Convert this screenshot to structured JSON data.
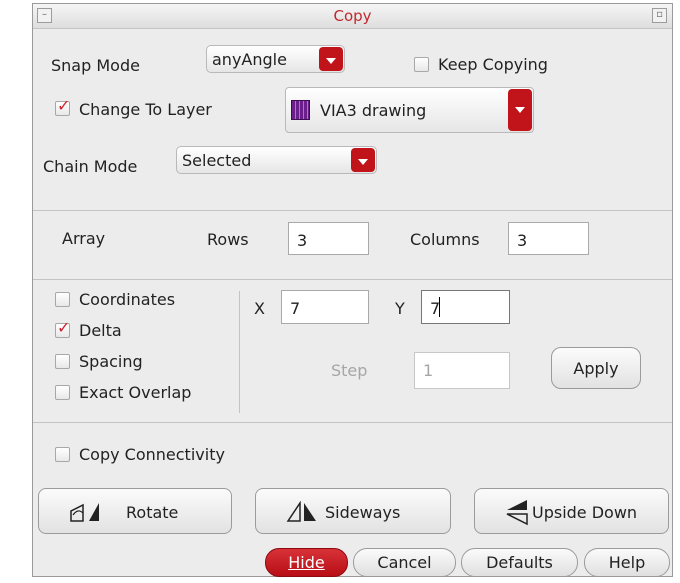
{
  "window": {
    "title": "Copy",
    "minimize_glyph": "–",
    "maximize_glyph": "▫"
  },
  "snap_mode": {
    "label": "Snap Mode",
    "value": "anyAngle"
  },
  "keep_copying": {
    "label": "Keep Copying",
    "checked": false
  },
  "change_to_layer": {
    "label": "Change To Layer",
    "checked": true,
    "value": "VIA3 drawing",
    "swatch_color": "#6a1f8a"
  },
  "chain_mode": {
    "label": "Chain Mode",
    "value": "Selected"
  },
  "array": {
    "label": "Array",
    "rows_label": "Rows",
    "rows_value": "3",
    "columns_label": "Columns",
    "columns_value": "3"
  },
  "mode": {
    "coordinates": {
      "label": "Coordinates",
      "checked": false
    },
    "delta": {
      "label": "Delta",
      "checked": true
    },
    "spacing": {
      "label": "Spacing",
      "checked": false
    },
    "exact_overlap": {
      "label": "Exact Overlap",
      "checked": false
    }
  },
  "offset": {
    "x_label": "X",
    "x_value": "7",
    "y_label": "Y",
    "y_value": "7",
    "step_label": "Step",
    "step_value": "1",
    "apply_label": "Apply"
  },
  "copy_connectivity": {
    "label": "Copy Connectivity",
    "checked": false
  },
  "transform_buttons": {
    "rotate": "Rotate",
    "sideways": "Sideways",
    "upside_down": "Upside Down"
  },
  "footer": {
    "hide": "Hide",
    "cancel": "Cancel",
    "defaults": "Defaults",
    "help": "Help"
  },
  "colors": {
    "accent": "#c0141a",
    "title_text": "#c0282d",
    "dialog_bg": "#ececec"
  },
  "icons": [
    "window-minimize-icon",
    "window-maximize-icon",
    "dropdown-arrow-icon",
    "layer-swatch-icon",
    "check-icon",
    "rotate-icon",
    "sideways-icon",
    "upside-down-icon"
  ]
}
